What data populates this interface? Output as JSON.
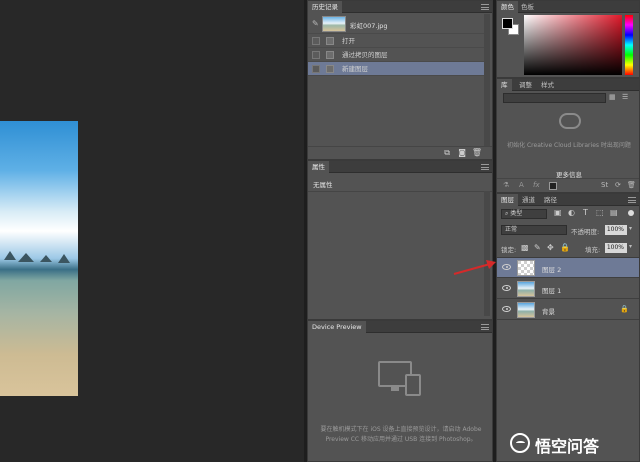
{
  "history": {
    "tab_title": "历史记录",
    "snapshot_name": "彩虹007.jpg",
    "items": [
      {
        "label": "打开"
      },
      {
        "label": "通过拷贝的图层"
      },
      {
        "label": "新建图层"
      }
    ]
  },
  "properties": {
    "tab_title": "属性",
    "content": "无属性"
  },
  "device_preview": {
    "tab_title": "Device Preview",
    "description": "要在触机模式下在 iOS 设备上直接预览设计，请启动 Adobe Preview CC 移动应用并通过 USB 连接到 Photoshop。"
  },
  "color": {
    "tabs": [
      "颜色",
      "色板"
    ]
  },
  "library": {
    "tabs": [
      "库",
      "调整",
      "样式"
    ],
    "message": "初始化 Creative Cloud Libraries 时出现问题",
    "more_info": "更多信息"
  },
  "layers": {
    "tabs": [
      "图层",
      "通道",
      "路径"
    ],
    "filter_kind": "类型",
    "blend_mode": "正常",
    "opacity_label": "不透明度:",
    "opacity_value": "100%",
    "lock_label": "锁定:",
    "fill_label": "填充:",
    "fill_value": "100%",
    "items": [
      {
        "name": "图层 2",
        "selected": true
      },
      {
        "name": "图层 1",
        "selected": false
      },
      {
        "name": "背景",
        "selected": false,
        "locked": true
      }
    ]
  },
  "watermark": {
    "text": "悟空问答"
  },
  "colors": {
    "selection": "#6e7a96",
    "annotation_arrow": "#d42a2a"
  }
}
